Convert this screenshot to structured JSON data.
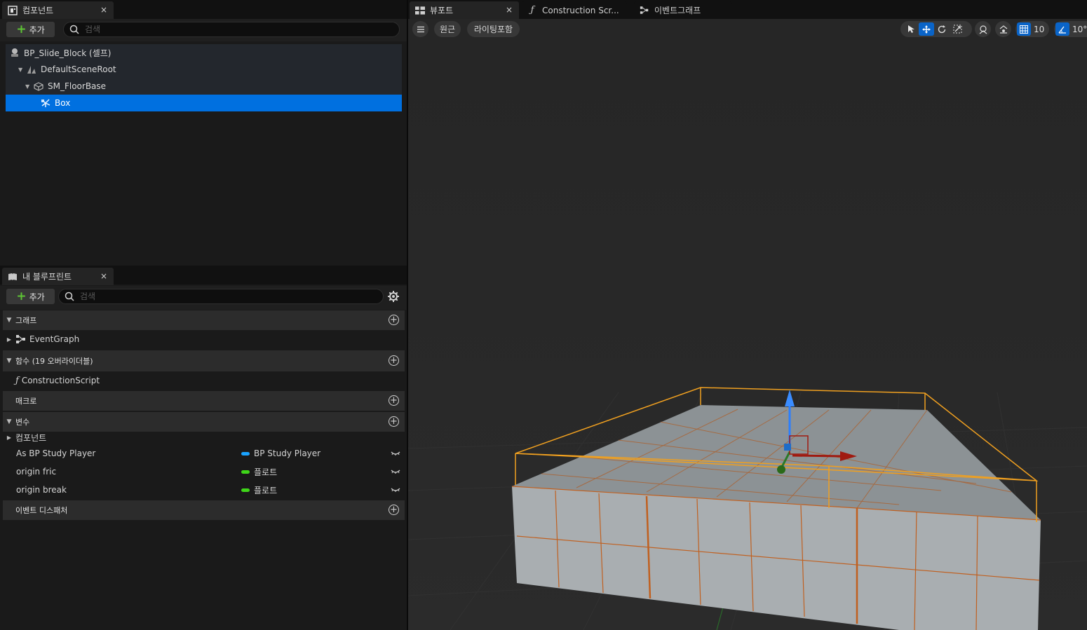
{
  "components_panel": {
    "tab_title": "컴포넌트",
    "close": "×",
    "add_label": "추가",
    "search_placeholder": "검색",
    "tree": [
      {
        "label": "BP_Slide_Block (셀프)",
        "icon": "actor-icon"
      },
      {
        "label": "DefaultSceneRoot",
        "icon": "scene-root-icon"
      },
      {
        "label": "SM_FloorBase",
        "icon": "static-mesh-icon"
      },
      {
        "label": "Box",
        "icon": "box-collision-icon",
        "selected": true
      }
    ]
  },
  "blueprint_panel": {
    "tab_title": "내 블루프린트",
    "close": "×",
    "add_label": "추가",
    "search_placeholder": "검색",
    "sections": {
      "graph": "그래프",
      "functions": "함수 (19 오버라이더블)",
      "macros": "매크로",
      "variables": "변수",
      "dispatchers": "이벤트 디스패처"
    },
    "graph_items": [
      "EventGraph"
    ],
    "function_items": [
      "ConstructionScript"
    ],
    "variable_category": "컴포넌트",
    "variables": [
      {
        "name": "As BP Study Player",
        "type": "BP Study Player",
        "color": "#1aa3ff"
      },
      {
        "name": "origin fric",
        "type": "플로트",
        "color": "#3fd619"
      },
      {
        "name": "origin break",
        "type": "플로트",
        "color": "#3fd619"
      }
    ]
  },
  "viewport": {
    "tabs": [
      {
        "label": "뷰포트",
        "icon": "viewport-grid-icon",
        "close": "×"
      },
      {
        "label": "Construction Scr...",
        "icon": "function-icon"
      },
      {
        "label": "이벤트그래프",
        "icon": "event-graph-icon"
      }
    ],
    "menu_icon": "hamburger-icon",
    "perspective_label": "원근",
    "lighting_label": "라이팅포함",
    "grid_snap_value": "10",
    "rotation_snap_value": "10°",
    "accent_color": "#0a64c8",
    "selection_color": "#f0a020"
  }
}
